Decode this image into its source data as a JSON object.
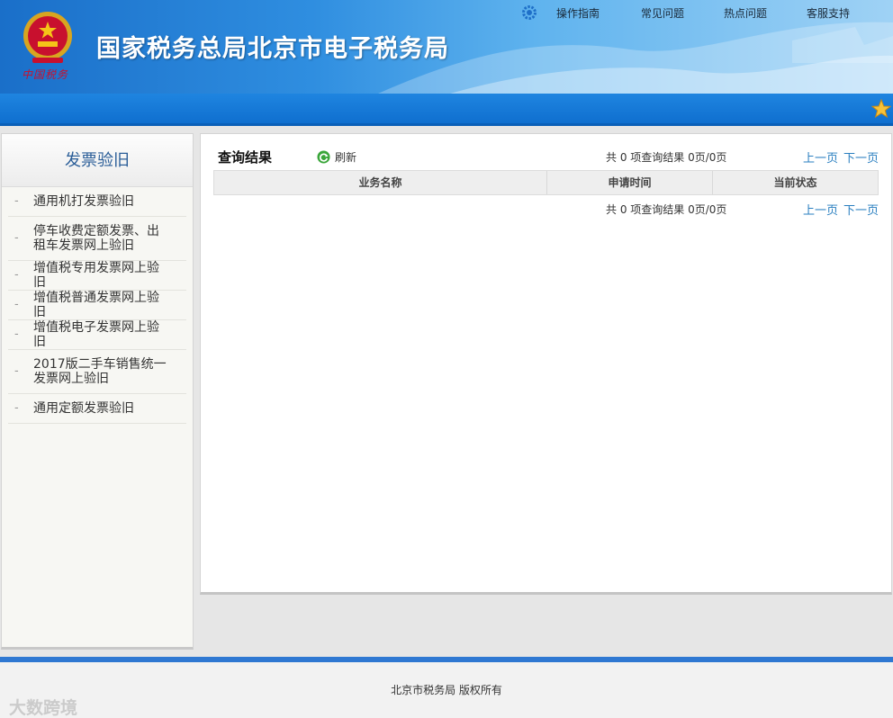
{
  "header": {
    "site_title": "国家税务总局北京市电子税务局",
    "brand_small": "中国税务",
    "nav": [
      {
        "label": "操作指南"
      },
      {
        "label": "常见问题"
      },
      {
        "label": "热点问题"
      },
      {
        "label": "客服支持"
      }
    ]
  },
  "sidebar": {
    "title": "发票验旧",
    "items": [
      {
        "label": "通用机打发票验旧"
      },
      {
        "label": "停车收费定额发票、出租车发票网上验旧"
      },
      {
        "label": "增值税专用发票网上验旧"
      },
      {
        "label": "增值税普通发票网上验旧"
      },
      {
        "label": "增值税电子发票网上验旧"
      },
      {
        "label": "2017版二手车销售统一发票网上验旧"
      },
      {
        "label": "通用定额发票验旧"
      }
    ]
  },
  "main": {
    "result_title": "查询结果",
    "refresh_label": "刷新",
    "pager_text": "共 0 项查询结果 0页/0页",
    "prev_label": "上一页",
    "next_label": "下一页",
    "columns": [
      "业务名称",
      "申请时间",
      "当前状态"
    ]
  },
  "footer": {
    "copyright": "北京市税务局 版权所有",
    "watermark": "大数跨境"
  },
  "colors": {
    "header_blue": "#1a6fc9",
    "link_blue": "#2a7fc0",
    "sidebar_title": "#2b5e98",
    "footer_border": "#2f78d2"
  },
  "icons": {
    "nav": "gear-icon",
    "refresh": "refresh-icon",
    "emblem": "national-emblem-icon",
    "favorite": "star-icon"
  }
}
